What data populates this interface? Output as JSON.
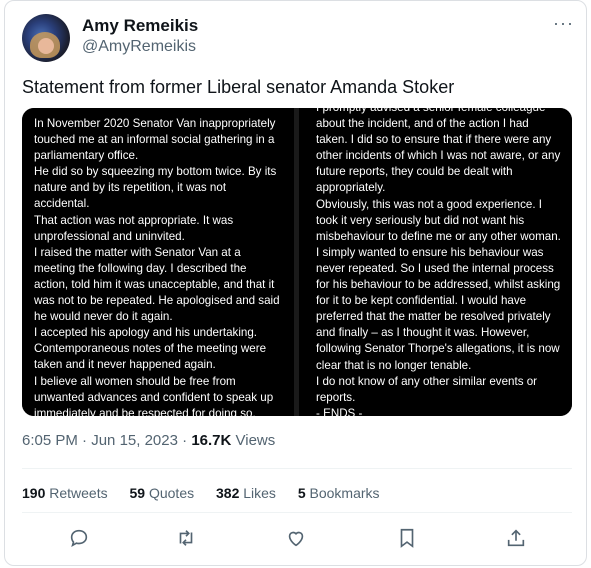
{
  "author": {
    "display_name": "Amy Remeikis",
    "handle": "@AmyRemeikis"
  },
  "more_icon": "more-horizontal-icon",
  "tweet": {
    "text": "Statement from former Liberal senator Amanda Stoker",
    "time": "6:05 PM",
    "date": "Jun 15, 2023",
    "separator": "·",
    "views_count": "16.7K",
    "views_label": "Views"
  },
  "statement": {
    "left_lines": [
      "In November 2020 Senator Van inappropriately",
      "touched me at an informal social gathering in a",
      "parliamentary office.",
      "He did so by squeezing my bottom twice.  By its",
      "nature and by its repetition, it was not",
      "accidental.",
      "That action was not appropriate. It was",
      "unprofessional and uninvited.",
      "I raised the matter with Senator Van at a",
      "meeting the following day.  I described the",
      "action, told him it was unacceptable, and that it",
      "was not to be repeated.  He apologised and said",
      "he would never do it again.",
      "I accepted his apology and his undertaking.",
      "Contemporaneous notes of the meeting were",
      "taken and it never happened again.",
      "I believe all women should be free from",
      "unwanted advances and confident to speak up",
      "immediately and be respected for doing so."
    ],
    "right_lines": [
      "I promptly advised a senior female colleague",
      "about the incident, and of the action I had",
      "taken.  I did so to ensure that if there were any",
      "other incidents of which I was not aware, or any",
      "future reports, they could be dealt with",
      "appropriately.",
      "Obviously, this was not a good experience.  I",
      "took it very seriously but did not want his",
      "misbehaviour to define me or any other woman.",
      "I simply wanted to ensure his behaviour was",
      "never repeated.  So I used the internal process",
      "for his behaviour to be addressed, whilst asking",
      "for it to be kept confidential.  I would have",
      "preferred that the matter be resolved privately",
      "and finally – as I thought it was. However,",
      "following Senator Thorpe's allegations, it is now",
      "clear that is no longer tenable.",
      "I do not know of any other similar events or",
      "reports.",
      "- ENDS -"
    ]
  },
  "stats": {
    "retweets_count": "190",
    "retweets_label": "Retweets",
    "quotes_count": "59",
    "quotes_label": "Quotes",
    "likes_count": "382",
    "likes_label": "Likes",
    "bookmarks_count": "5",
    "bookmarks_label": "Bookmarks"
  },
  "actions": [
    "reply-icon",
    "retweet-icon",
    "like-icon",
    "bookmark-icon",
    "share-icon"
  ],
  "colors": {
    "text_primary": "#0f1419",
    "text_secondary": "#536471",
    "divider": "#eff3f4",
    "statement_background": "#000000"
  }
}
